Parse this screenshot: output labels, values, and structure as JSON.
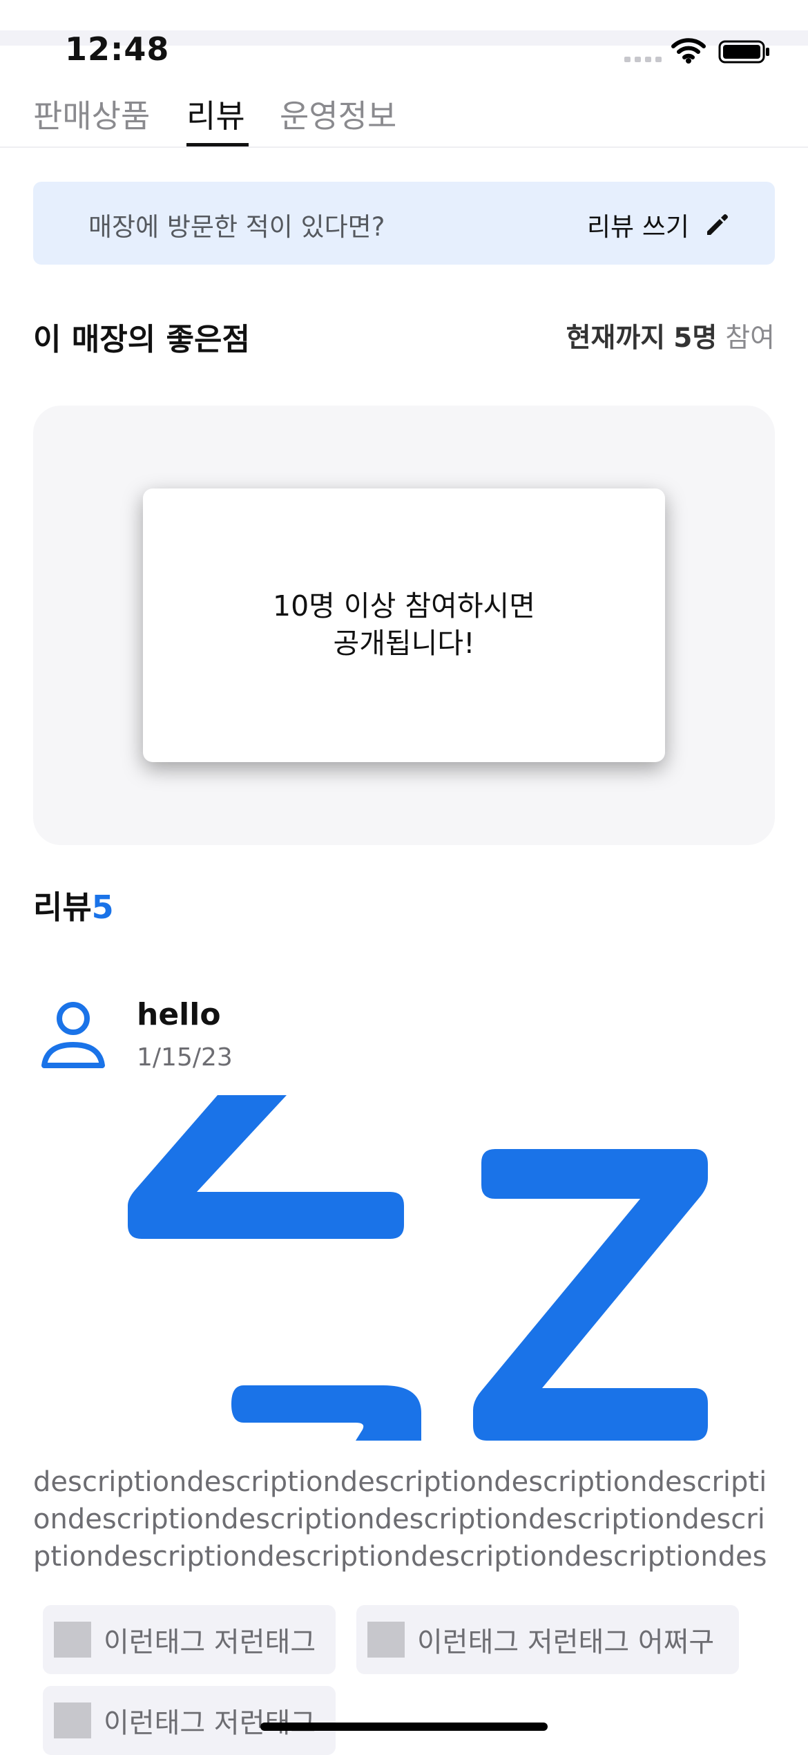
{
  "status_bar": {
    "time": "12:48"
  },
  "tabs": [
    {
      "label": "판매상품",
      "active": false
    },
    {
      "label": "리뷰",
      "active": true
    },
    {
      "label": "운영정보",
      "active": false
    }
  ],
  "banner": {
    "prompt": "매장에 방문한 적이 있다면?",
    "write_label": "리뷰 쓰기",
    "write_icon": "pencil-icon"
  },
  "good_points": {
    "title": "이 매장의 좋은점",
    "participants_prefix": "현재까지",
    "participants_count": "5명",
    "participants_suffix": "참여",
    "locked_message_line1": "10명 이상 참여하시면",
    "locked_message_line2": "공개됩니다!"
  },
  "reviews": {
    "title": "리뷰",
    "count": "5",
    "items": [
      {
        "author": "hello",
        "date": "1/15/23",
        "avatar_icon": "person-icon",
        "image_icon": "sleep-zz-icon",
        "description": "descriptiondescriptiondescriptiondescriptiondescriptiondescriptiondescriptiondescriptiondescriptiondescriptiondescriptiondescriptiondescriptiondescriptiondescri...",
        "tags": [
          "이런태그 저런태그",
          "이런태그 저런태그 어쩌구",
          "이런태그 저런태그"
        ]
      }
    ]
  },
  "colors": {
    "accent_blue": "#1a73e8",
    "banner_bg": "#e6effd",
    "panel_bg": "#f6f6f8",
    "tag_bg": "#f2f2f7"
  }
}
